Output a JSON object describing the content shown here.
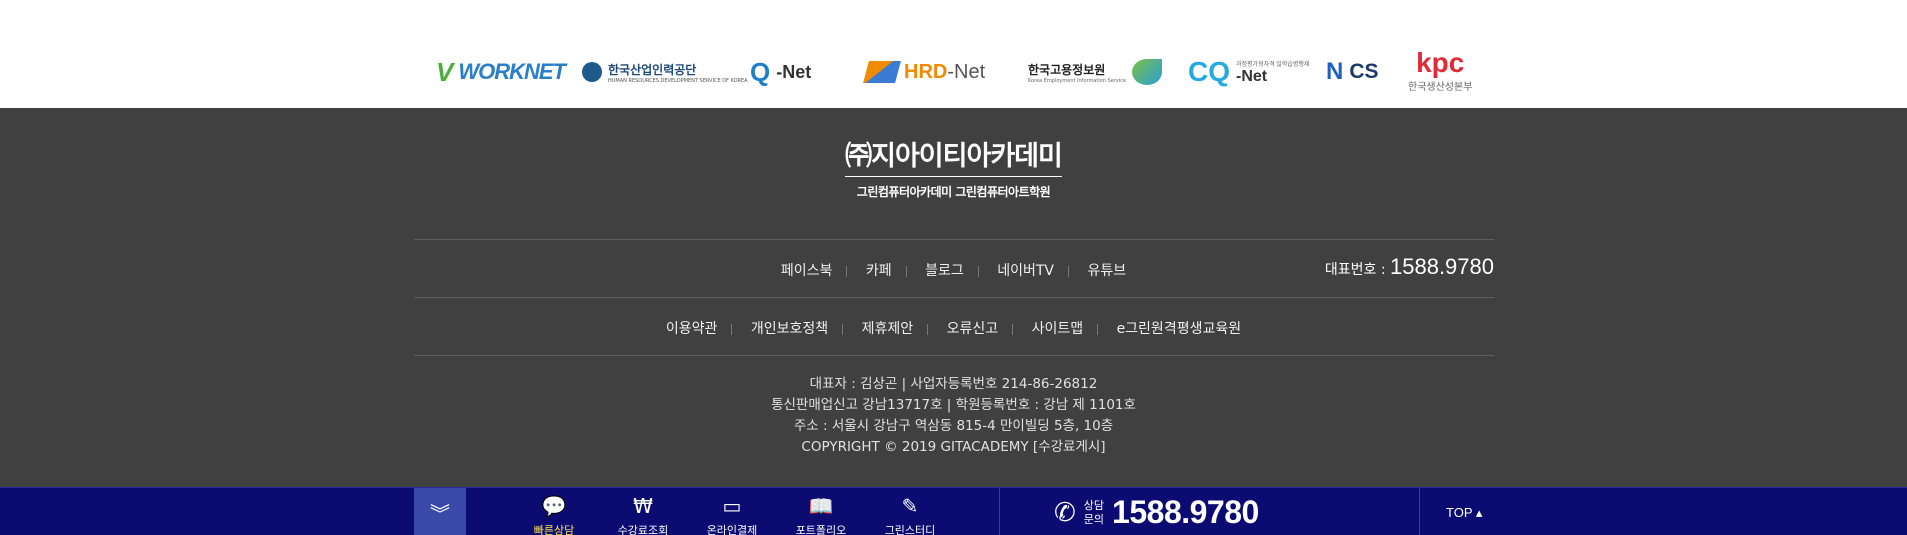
{
  "partners": {
    "worknet": "WORKNET",
    "hrdkorea": "한국산업인력공단",
    "hrdkorea_sub": "HUMAN RESOURCES DEVELOPMENT SERVICE OF KOREA",
    "qnet": "-Net",
    "hrdnet_a": "HRD",
    "hrdnet_b": "-Net",
    "keis": "한국고용정보원",
    "keis_sub": "Korea Employment Information Service",
    "cqnet": "-Net",
    "cqnet_sub": "과정평가형자격 일학습병행제",
    "ncs": "CS",
    "kpc": "kpc",
    "kpc_sub": "한국생산성본부"
  },
  "brand": {
    "name": "㈜지아이티아카데미",
    "sub": "그린컴퓨터아카데미 그린컴퓨터아트학원"
  },
  "sns": [
    "페이스북",
    "카페",
    "블로그",
    "네이버TV",
    "유튜브"
  ],
  "tel": {
    "label": "대표번호 : ",
    "number": "1588.9780"
  },
  "policy": [
    "이용약관",
    "개인보호정책",
    "제휴제안",
    "오류신고",
    "사이트맵",
    "e그린원격평생교육원"
  ],
  "info": {
    "line1": "대표자 : 김상곤 | 사업자등록번호 214-86-26812",
    "line2": "통신판매업신고 강남13717호 | 학원등록번호 : 강남 제 1101호",
    "line3": "주소 : 서울시 강남구 역삼동 815-4 만이빌딩 5층, 10층",
    "line4": "COPYRIGHT © 2019 GITACADEMY [수강료게시]"
  },
  "quickbar": {
    "items": [
      {
        "label": "빠른상담",
        "icon": "chat-icon",
        "active": true
      },
      {
        "label": "수강료조회",
        "icon": "won-icon",
        "active": false
      },
      {
        "label": "온라인결제",
        "icon": "wallet-icon",
        "active": false
      },
      {
        "label": "포트폴리오",
        "icon": "book-icon",
        "active": false
      },
      {
        "label": "그린스터디",
        "icon": "pen-icon",
        "active": false
      }
    ],
    "consult_label_1": "상담",
    "consult_label_2": "문의",
    "consult_number": "1588.9780",
    "top_label": "TOP"
  }
}
